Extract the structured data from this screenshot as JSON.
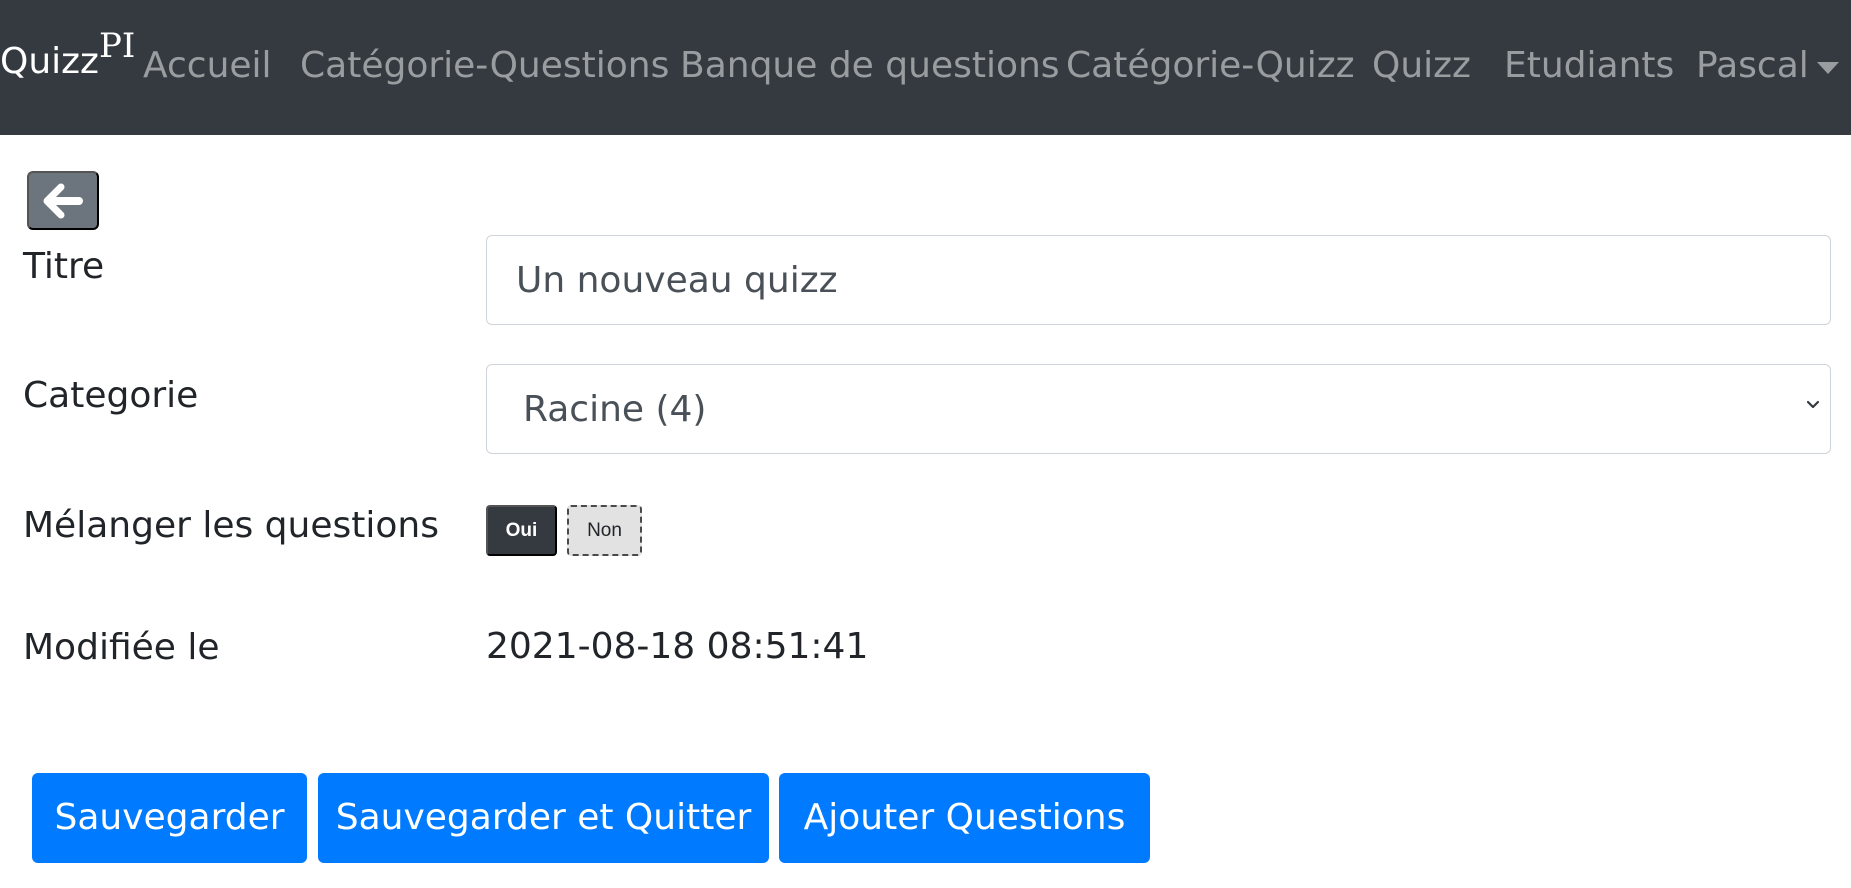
{
  "navbar": {
    "brand": {
      "text": "Quizz",
      "sup": "PI"
    },
    "items": [
      {
        "label": "Accueil"
      },
      {
        "label": "Catégorie-Questions"
      },
      {
        "label": "Banque de questions"
      },
      {
        "label": "Catégorie-Quizz"
      },
      {
        "label": "Quizz"
      },
      {
        "label": "Etudiants"
      },
      {
        "label": "Pascal",
        "icon": "caret-down-icon"
      }
    ]
  },
  "back_button": {
    "icon": "arrow-left-icon"
  },
  "form": {
    "title": {
      "label": "Titre",
      "value": "Un nouveau quizz"
    },
    "category": {
      "label": "Categorie",
      "selected": "Racine (4)"
    },
    "shuffle": {
      "label": "Mélanger les questions",
      "yes": "Oui",
      "no": "Non",
      "selected": "Oui"
    },
    "modified": {
      "label": "Modifiée le",
      "value": "2021-08-18 08:51:41"
    }
  },
  "actions": {
    "save": "Sauvegarder",
    "save_quit": "Sauvegarder et Quitter",
    "add_questions": "Ajouter Questions"
  },
  "colors": {
    "navbar_bg": "#343a40",
    "primary": "#007bff",
    "secondary": "#6c757d",
    "toggle_active": "#343a40"
  }
}
